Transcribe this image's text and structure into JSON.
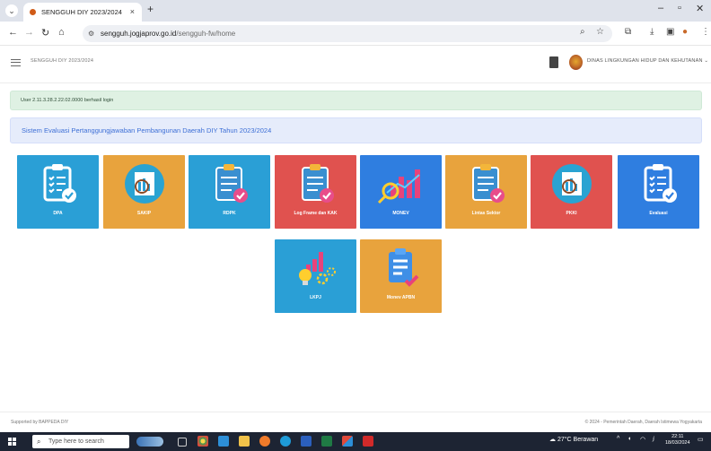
{
  "browser": {
    "tab_title": "SENGGUH DIY 2023/2024",
    "tab_close": "×",
    "new_tab": "+",
    "url_host": "sengguh.jogjaprov.go.id",
    "url_path": "/sengguh-fw/home"
  },
  "header": {
    "app_name": "SENGGUH DIY 2023/2024",
    "department": "DINAS LINGKUNGAN HIDUP DAN KEHUTANAN"
  },
  "alert": {
    "text": "User 2.11.3.28.2.22.02.0000 berhasil login"
  },
  "banner": {
    "text": "Sistem Evaluasi Pertanggungjawaban Pembangunan Daerah DIY Tahun 2023/2024"
  },
  "menu": [
    {
      "label": "DPA",
      "color": "#2a9fd6",
      "icon": "clipboard-check-icon"
    },
    {
      "label": "SAKIP",
      "color": "#e8a33d",
      "icon": "report-search-icon"
    },
    {
      "label": "RDPK",
      "color": "#2a9fd6",
      "icon": "clipboard-pink-check-icon"
    },
    {
      "label": "Log Frame dan KAK",
      "color": "#e0524f",
      "icon": "clipboard-pink-check-icon"
    },
    {
      "label": "MONEV",
      "color": "#2f7ee0",
      "icon": "chart-magnifier-icon"
    },
    {
      "label": "Lintas Sektor",
      "color": "#e8a33d",
      "icon": "clipboard-pink-check-icon"
    },
    {
      "label": "PKKI",
      "color": "#e0524f",
      "icon": "report-search-icon"
    },
    {
      "label": "Evaluasi",
      "color": "#2f7ee0",
      "icon": "clipboard-check-icon"
    },
    {
      "label": "LKPJ",
      "color": "#2a9fd6",
      "icon": "chart-bulb-gear-icon"
    },
    {
      "label": "Monev APBN",
      "color": "#e8a33d",
      "icon": "clipboard-list-check-icon"
    }
  ],
  "footer": {
    "left": "Supported by BAPPEDA DIY",
    "right": "© 2024 - Pemerintah Daerah, Daerah Istimewa Yogyakarta"
  },
  "taskbar": {
    "search_placeholder": "Type here to search",
    "weather": "27°C  Berawan",
    "time": "22:11",
    "date": "18/03/2024"
  }
}
